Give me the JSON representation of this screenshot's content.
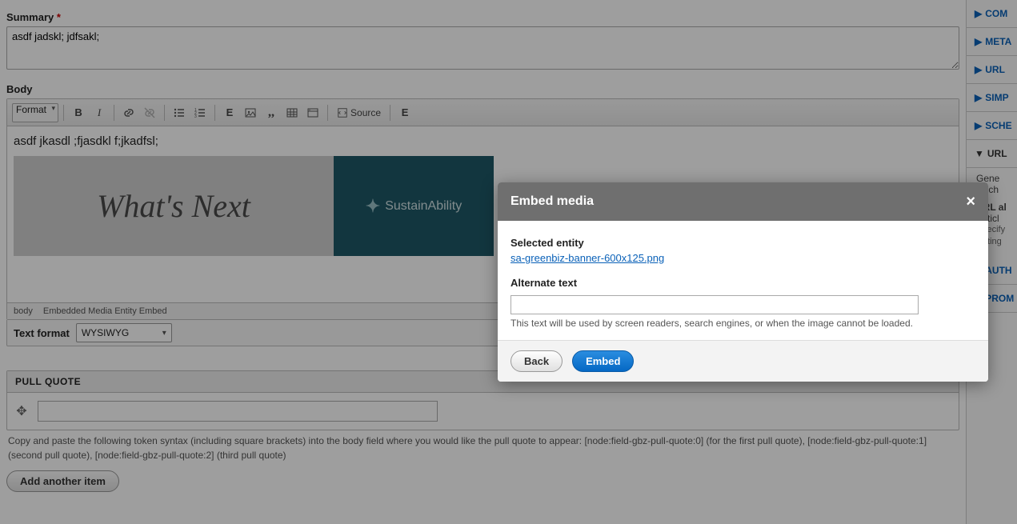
{
  "summary": {
    "label": "Summary",
    "required_mark": "*",
    "value": "asdf jadskl; jdfsakl;"
  },
  "body": {
    "label": "Body",
    "toolbar": {
      "format_label": "Format",
      "source_label": "Source"
    },
    "text": "asdf jkasdl ;fjasdkl f;jkadfsl;",
    "banner_left": "What's Next",
    "banner_right": "SustainAbility",
    "path_body": "body",
    "path_embed": "Embedded Media Entity Embed"
  },
  "text_format": {
    "label": "Text format",
    "value": "WYSIWYG"
  },
  "pull_quote": {
    "title": "PULL QUOTE",
    "value": "",
    "help": "Copy and paste the following token syntax (including square brackets) into the body field where you would like the pull quote to appear: [node:field-gbz-pull-quote:0] (for the first pull quote), [node:field-gbz-pull-quote:1] (second pull quote), [node:field-gbz-pull-quote:2] (third pull quote)",
    "add_button": "Add another item"
  },
  "sidebar": {
    "items": [
      {
        "label": "COM"
      },
      {
        "label": "META"
      },
      {
        "label": "URL"
      },
      {
        "label": "SIMP"
      },
      {
        "label": "SCHE"
      }
    ],
    "expanded_label": "URL",
    "gen_line1": "Gene",
    "gen_line2": "Unch",
    "alias_label": "URL al",
    "alias_value": "/articl",
    "alias_hint1": "Specify",
    "alias_hint2": "writing",
    "auth_label": "AUTH",
    "prom_label": "PROM"
  },
  "dialog": {
    "title": "Embed media",
    "selected_label": "Selected entity",
    "selected_link": "sa-greenbiz-banner-600x125.png",
    "alt_label": "Alternate text",
    "alt_value": "",
    "alt_hint": "This text will be used by screen readers, search engines, or when the image cannot be loaded.",
    "back_button": "Back",
    "embed_button": "Embed"
  }
}
